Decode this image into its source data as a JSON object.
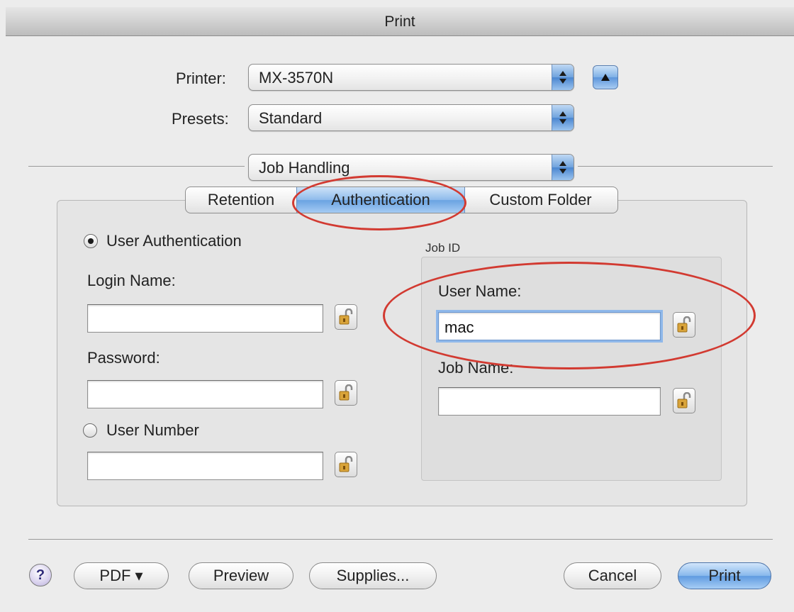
{
  "window": {
    "title": "Print"
  },
  "printer": {
    "label": "Printer:",
    "value": "MX-3570N"
  },
  "presets": {
    "label": "Presets:",
    "value": "Standard"
  },
  "section_popup": {
    "value": "Job Handling"
  },
  "tabs": [
    {
      "label": "Retention",
      "active": false
    },
    {
      "label": "Authentication",
      "active": true
    },
    {
      "label": "Custom Folder",
      "active": false
    }
  ],
  "auth": {
    "user_auth_label": "User Authentication",
    "user_auth_selected": true,
    "login_name_label": "Login Name:",
    "login_name_value": "",
    "password_label": "Password:",
    "password_value": "",
    "user_number_label": "User Number",
    "user_number_selected": false,
    "user_number_value": ""
  },
  "job_id": {
    "group_label": "Job ID",
    "user_name_label": "User Name:",
    "user_name_value": "mac",
    "job_name_label": "Job Name:",
    "job_name_value": ""
  },
  "buttons": {
    "help": "?",
    "pdf": "PDF ▾",
    "preview": "Preview",
    "supplies": "Supplies...",
    "cancel": "Cancel",
    "print": "Print"
  },
  "colors": {
    "annotation": "#d23a31",
    "accent": "#6fa2dd",
    "window_bg": "#ececec"
  }
}
